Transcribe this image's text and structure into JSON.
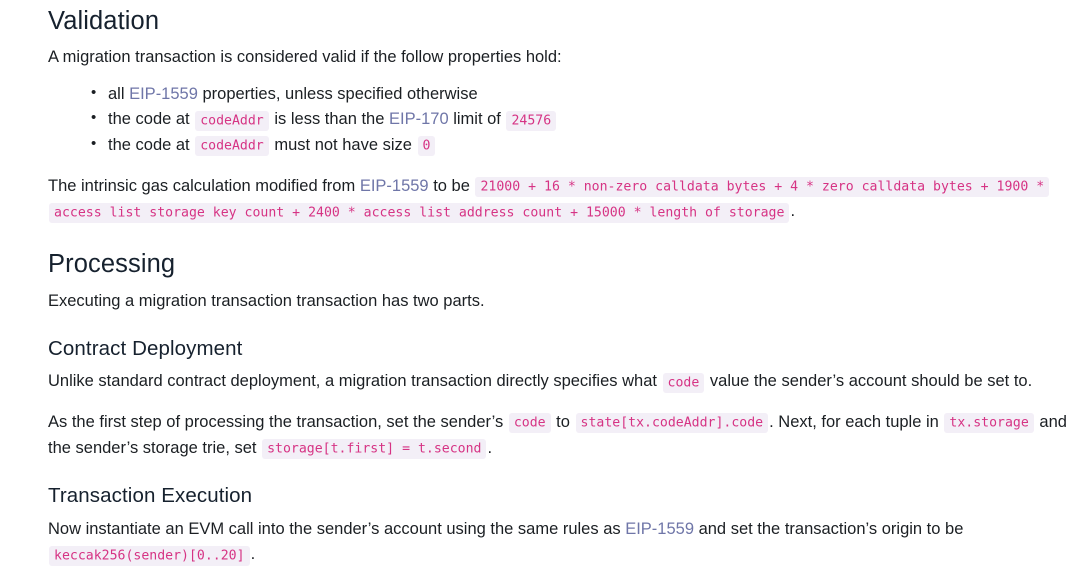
{
  "sections": {
    "validation": {
      "heading": "Validation",
      "intro": "A migration transaction is considered valid if the follow properties hold:",
      "bullets": [
        {
          "pre": "all ",
          "link": "EIP-1559",
          "post": " properties, unless specified otherwise"
        },
        {
          "pre": "the code at ",
          "code1": "codeAddr",
          "mid": " is less than the ",
          "link": "EIP-170",
          "post": " limit of ",
          "code2": "24576"
        },
        {
          "pre": "the code at ",
          "code1": "codeAddr",
          "post": " must not have size ",
          "code2": "0"
        }
      ],
      "gas": {
        "pre": "The intrinsic gas calculation modified from ",
        "link": "EIP-1559",
        "mid": " to be ",
        "formula": "21000 + 16 * non-zero calldata bytes + 4 * zero calldata bytes + 1900 * access list storage key count + 2400 * access list address count + 15000 * length of storage",
        "post": "."
      }
    },
    "processing": {
      "heading": "Processing",
      "intro": "Executing a migration transaction transaction has two parts."
    },
    "contract_deployment": {
      "heading": "Contract Deployment",
      "para1": {
        "pre": "Unlike standard contract deployment, a migration transaction directly specifies what ",
        "code": "code",
        "post": " value the sender’s account should be set to."
      },
      "para2": {
        "pre": "As the first step of processing the transaction, set the sender’s ",
        "code1": "code",
        "mid1": " to ",
        "code2": "state[tx.codeAddr].code",
        "mid2": ". Next, for each tuple in ",
        "code3": "tx.storage",
        "mid3": " and the sender’s storage trie, set ",
        "code4": "storage[t.first] = t.second",
        "post": "."
      }
    },
    "transaction_execution": {
      "heading": "Transaction Execution",
      "para": {
        "pre": "Now instantiate an EVM call into the sender’s account using the same rules as ",
        "link": "EIP-1559",
        "mid": " and set the transaction’s origin to be ",
        "code": "keccak256(sender)[0..20]",
        "post": "."
      }
    }
  },
  "colors": {
    "link": "#6f76a8",
    "code_text": "#d63384",
    "code_bg": "#f3eff7",
    "heading": "#16212e",
    "body_text": "#1b1f23",
    "page_bg": "#ffffff"
  }
}
